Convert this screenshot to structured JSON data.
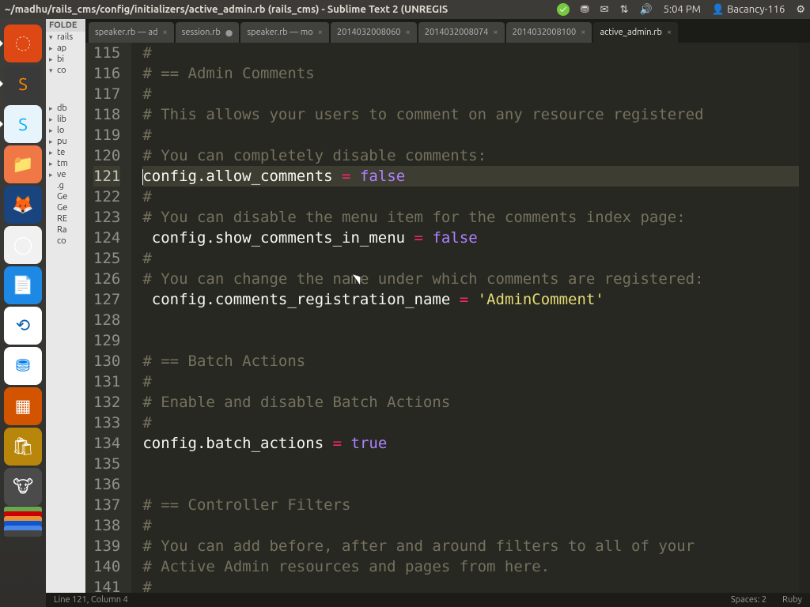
{
  "menubar": {
    "title": "~/madhu/rails_cms/config/initializers/active_admin.rb (rails_cms) - Sublime Text 2 (UNREGIS",
    "time": "5:04 PM",
    "user": "Bacancy-116"
  },
  "launcher": {
    "tiles": [
      {
        "bg": "#dd4814",
        "glyph": "◌",
        "name": "dash-icon"
      },
      {
        "bg": "#3a3a3a",
        "glyph": "S",
        "name": "sublime-icon",
        "text_color": "#ff8c00"
      },
      {
        "bg": "#e7f4fc",
        "glyph": "S",
        "name": "skype-icon",
        "text_color": "#00aff0"
      },
      {
        "bg": "#f07746",
        "glyph": "📁",
        "name": "files-icon"
      },
      {
        "bg": "#19447e",
        "glyph": "🦊",
        "name": "firefox-icon"
      },
      {
        "bg": "#f1f1f1",
        "glyph": "◯",
        "name": "chrome-icon"
      },
      {
        "bg": "#1e88e5",
        "glyph": "📄",
        "name": "writer-icon"
      },
      {
        "bg": "#ffffff",
        "glyph": "⟲",
        "name": "teamviewer-icon",
        "text_color": "#0d62ab"
      },
      {
        "bg": "#ffffff",
        "glyph": "⛃",
        "name": "dropbox-icon",
        "text_color": "#007ee5"
      },
      {
        "bg": "#d35400",
        "glyph": "▦",
        "name": "impress-icon"
      },
      {
        "bg": "#b8860b",
        "glyph": "🛍",
        "name": "software-icon"
      },
      {
        "bg": "#4b4b4b",
        "glyph": "🐮",
        "name": "gimp-icon"
      }
    ],
    "chips": [
      "#6aa84f",
      "#cc0000",
      "#e69138",
      "#1155cc",
      "#4a86e8",
      "#444444"
    ]
  },
  "sidebar": {
    "header": "FOLDE",
    "items": [
      {
        "arrow": "▾",
        "label": "rails"
      },
      {
        "arrow": "▸",
        "label": "ap"
      },
      {
        "arrow": "▸",
        "label": "bi"
      },
      {
        "arrow": "▾",
        "label": "co"
      },
      {
        "arrow": "",
        "label": ""
      },
      {
        "arrow": "",
        "label": ""
      },
      {
        "arrow": "",
        "label": ""
      },
      {
        "arrow": "",
        "label": ""
      },
      {
        "arrow": "",
        "label": ""
      },
      {
        "arrow": "",
        "label": ""
      },
      {
        "arrow": "",
        "label": ""
      },
      {
        "arrow": "",
        "label": ""
      },
      {
        "arrow": "",
        "label": ""
      },
      {
        "arrow": "",
        "label": ""
      },
      {
        "arrow": "",
        "label": ""
      },
      {
        "arrow": "",
        "label": ""
      },
      {
        "arrow": "",
        "label": ""
      },
      {
        "arrow": "",
        "label": ""
      },
      {
        "arrow": "",
        "label": ""
      },
      {
        "arrow": "",
        "label": ""
      },
      {
        "arrow": "",
        "label": ""
      },
      {
        "arrow": "▸",
        "label": "db"
      },
      {
        "arrow": "▸",
        "label": "lib"
      },
      {
        "arrow": "▸",
        "label": "lo"
      },
      {
        "arrow": "▸",
        "label": "pu"
      },
      {
        "arrow": "▸",
        "label": "te"
      },
      {
        "arrow": "▸",
        "label": "tm"
      },
      {
        "arrow": "▸",
        "label": "ve"
      },
      {
        "arrow": "",
        "label": ".g"
      },
      {
        "arrow": "",
        "label": "Ge"
      },
      {
        "arrow": "",
        "label": "Ge"
      },
      {
        "arrow": "",
        "label": "RE"
      },
      {
        "arrow": "",
        "label": "Ra"
      },
      {
        "arrow": "",
        "label": "co"
      }
    ]
  },
  "tabs": [
    {
      "label": "speaker.rb — ad",
      "marker": "x",
      "active": false
    },
    {
      "label": "session.rb",
      "marker": "dot",
      "active": false
    },
    {
      "label": "speaker.rb — mo",
      "marker": "x",
      "active": false
    },
    {
      "label": "2014032008060",
      "marker": "x",
      "active": false
    },
    {
      "label": "2014032008074",
      "marker": "x",
      "active": false
    },
    {
      "label": "2014032008100",
      "marker": "x",
      "active": false
    },
    {
      "label": "active_admin.rb",
      "marker": "x",
      "active": true
    }
  ],
  "editor": {
    "first_line": 115,
    "highlight_line": 121,
    "lines": [
      {
        "t": "cmnt",
        "text": "#"
      },
      {
        "t": "cmnt",
        "text": "# == Admin Comments"
      },
      {
        "t": "cmnt",
        "text": "#"
      },
      {
        "t": "cmnt",
        "text": "# This allows your users to comment on any resource registered"
      },
      {
        "t": "cmnt",
        "text": "#"
      },
      {
        "t": "cmnt",
        "text": "# You can completely disable comments:"
      },
      {
        "t": "code",
        "segments": [
          {
            "c": "caret",
            "v": ""
          },
          {
            "c": "ident",
            "v": "config"
          },
          {
            "c": "punct",
            "v": "."
          },
          {
            "c": "ident",
            "v": "allow_comments"
          },
          {
            "c": "ident",
            "v": " "
          },
          {
            "c": "op",
            "v": "="
          },
          {
            "c": "ident",
            "v": " "
          },
          {
            "c": "bool",
            "v": "false"
          }
        ]
      },
      {
        "t": "cmnt",
        "text": "#"
      },
      {
        "t": "cmnt",
        "text": "# You can disable the menu item for the comments index page:"
      },
      {
        "t": "code",
        "segments": [
          {
            "c": "ident",
            "v": " config"
          },
          {
            "c": "punct",
            "v": "."
          },
          {
            "c": "ident",
            "v": "show_comments_in_menu"
          },
          {
            "c": "ident",
            "v": " "
          },
          {
            "c": "op",
            "v": "="
          },
          {
            "c": "ident",
            "v": " "
          },
          {
            "c": "bool",
            "v": "false"
          }
        ]
      },
      {
        "t": "cmnt",
        "text": "#"
      },
      {
        "t": "cmnt",
        "text": "# You can change the name under which comments are registered:"
      },
      {
        "t": "code",
        "segments": [
          {
            "c": "ident",
            "v": " config"
          },
          {
            "c": "punct",
            "v": "."
          },
          {
            "c": "ident",
            "v": "comments_registration_name"
          },
          {
            "c": "ident",
            "v": " "
          },
          {
            "c": "op",
            "v": "="
          },
          {
            "c": "ident",
            "v": " "
          },
          {
            "c": "str",
            "v": "'AdminComment'"
          }
        ]
      },
      {
        "t": "blank",
        "text": ""
      },
      {
        "t": "blank",
        "text": ""
      },
      {
        "t": "cmnt",
        "text": "# == Batch Actions"
      },
      {
        "t": "cmnt",
        "text": "#"
      },
      {
        "t": "cmnt",
        "text": "# Enable and disable Batch Actions"
      },
      {
        "t": "cmnt",
        "text": "#"
      },
      {
        "t": "code",
        "segments": [
          {
            "c": "ident",
            "v": "config"
          },
          {
            "c": "punct",
            "v": "."
          },
          {
            "c": "ident",
            "v": "batch_actions"
          },
          {
            "c": "ident",
            "v": " "
          },
          {
            "c": "op",
            "v": "="
          },
          {
            "c": "ident",
            "v": " "
          },
          {
            "c": "bool",
            "v": "true"
          }
        ]
      },
      {
        "t": "blank",
        "text": ""
      },
      {
        "t": "blank",
        "text": ""
      },
      {
        "t": "cmnt",
        "text": "# == Controller Filters"
      },
      {
        "t": "cmnt",
        "text": "#"
      },
      {
        "t": "cmnt",
        "text": "# You can add before, after and around filters to all of your"
      },
      {
        "t": "cmnt",
        "text": "# Active Admin resources and pages from here."
      },
      {
        "t": "cmnt",
        "text": "#"
      }
    ]
  },
  "status": {
    "pos": "Line 121, Column 4",
    "spaces": "Spaces: 2",
    "lang": "Ruby"
  }
}
